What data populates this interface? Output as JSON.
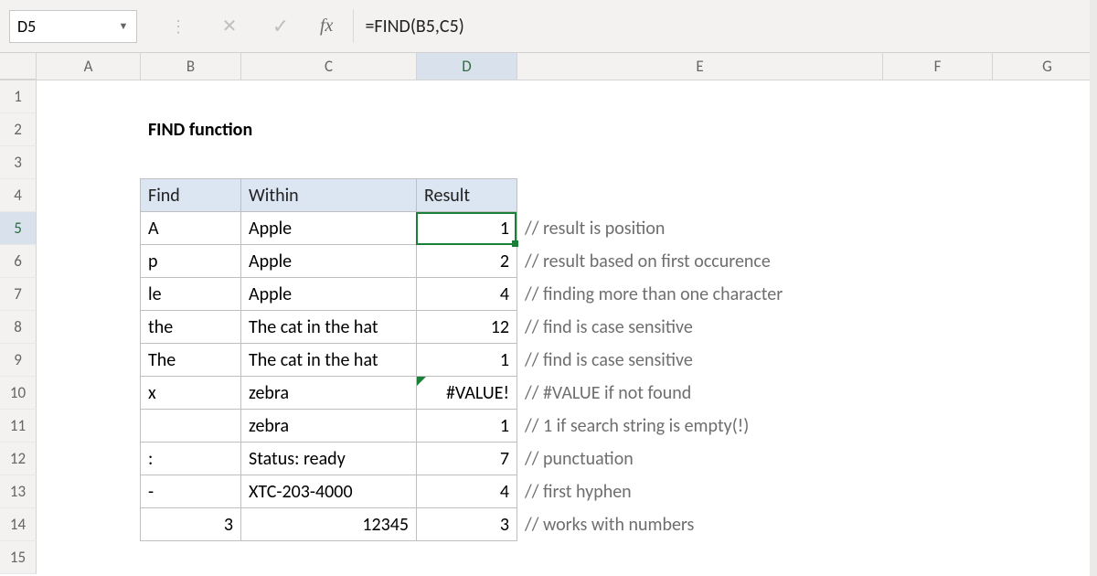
{
  "formula_bar": {
    "name_box": "D5",
    "fx_label": "fx",
    "formula": "=FIND(B5,C5)"
  },
  "columns": [
    "A",
    "B",
    "C",
    "D",
    "E",
    "F",
    "G"
  ],
  "rows": [
    "1",
    "2",
    "3",
    "4",
    "5",
    "6",
    "7",
    "8",
    "9",
    "10",
    "11",
    "12",
    "13",
    "14",
    "15"
  ],
  "active": {
    "col": "D",
    "row": "5"
  },
  "title": "FIND function",
  "table": {
    "headers": {
      "find": "Find",
      "within": "Within",
      "result": "Result"
    },
    "rows": [
      {
        "find": "A",
        "within": "Apple",
        "result": "1",
        "comment": "// result is position"
      },
      {
        "find": "p",
        "within": "Apple",
        "result": "2",
        "comment": "// result based on first occurence"
      },
      {
        "find": "le",
        "within": "Apple",
        "result": "4",
        "comment": "// finding more than one character"
      },
      {
        "find": "the",
        "within": "The cat in the hat",
        "result": "12",
        "comment": "// find is case sensitive"
      },
      {
        "find": "The",
        "within": "The cat in the hat",
        "result": "1",
        "comment": "// find is case sensitive"
      },
      {
        "find": "x",
        "within": "zebra",
        "result": "#VALUE!",
        "comment": "// #VALUE if not found"
      },
      {
        "find": "",
        "within": "zebra",
        "result": "1",
        "comment": "// 1 if search string is empty(!)"
      },
      {
        "find": ":",
        "within": "Status: ready",
        "result": "7",
        "comment": "// punctuation"
      },
      {
        "find": "-",
        "within": "XTC-203-4000",
        "result": "4",
        "comment": "// first hyphen"
      },
      {
        "find": "3",
        "within": "12345",
        "result": "3",
        "comment": "// works with numbers"
      }
    ]
  },
  "row_align_right": 9
}
